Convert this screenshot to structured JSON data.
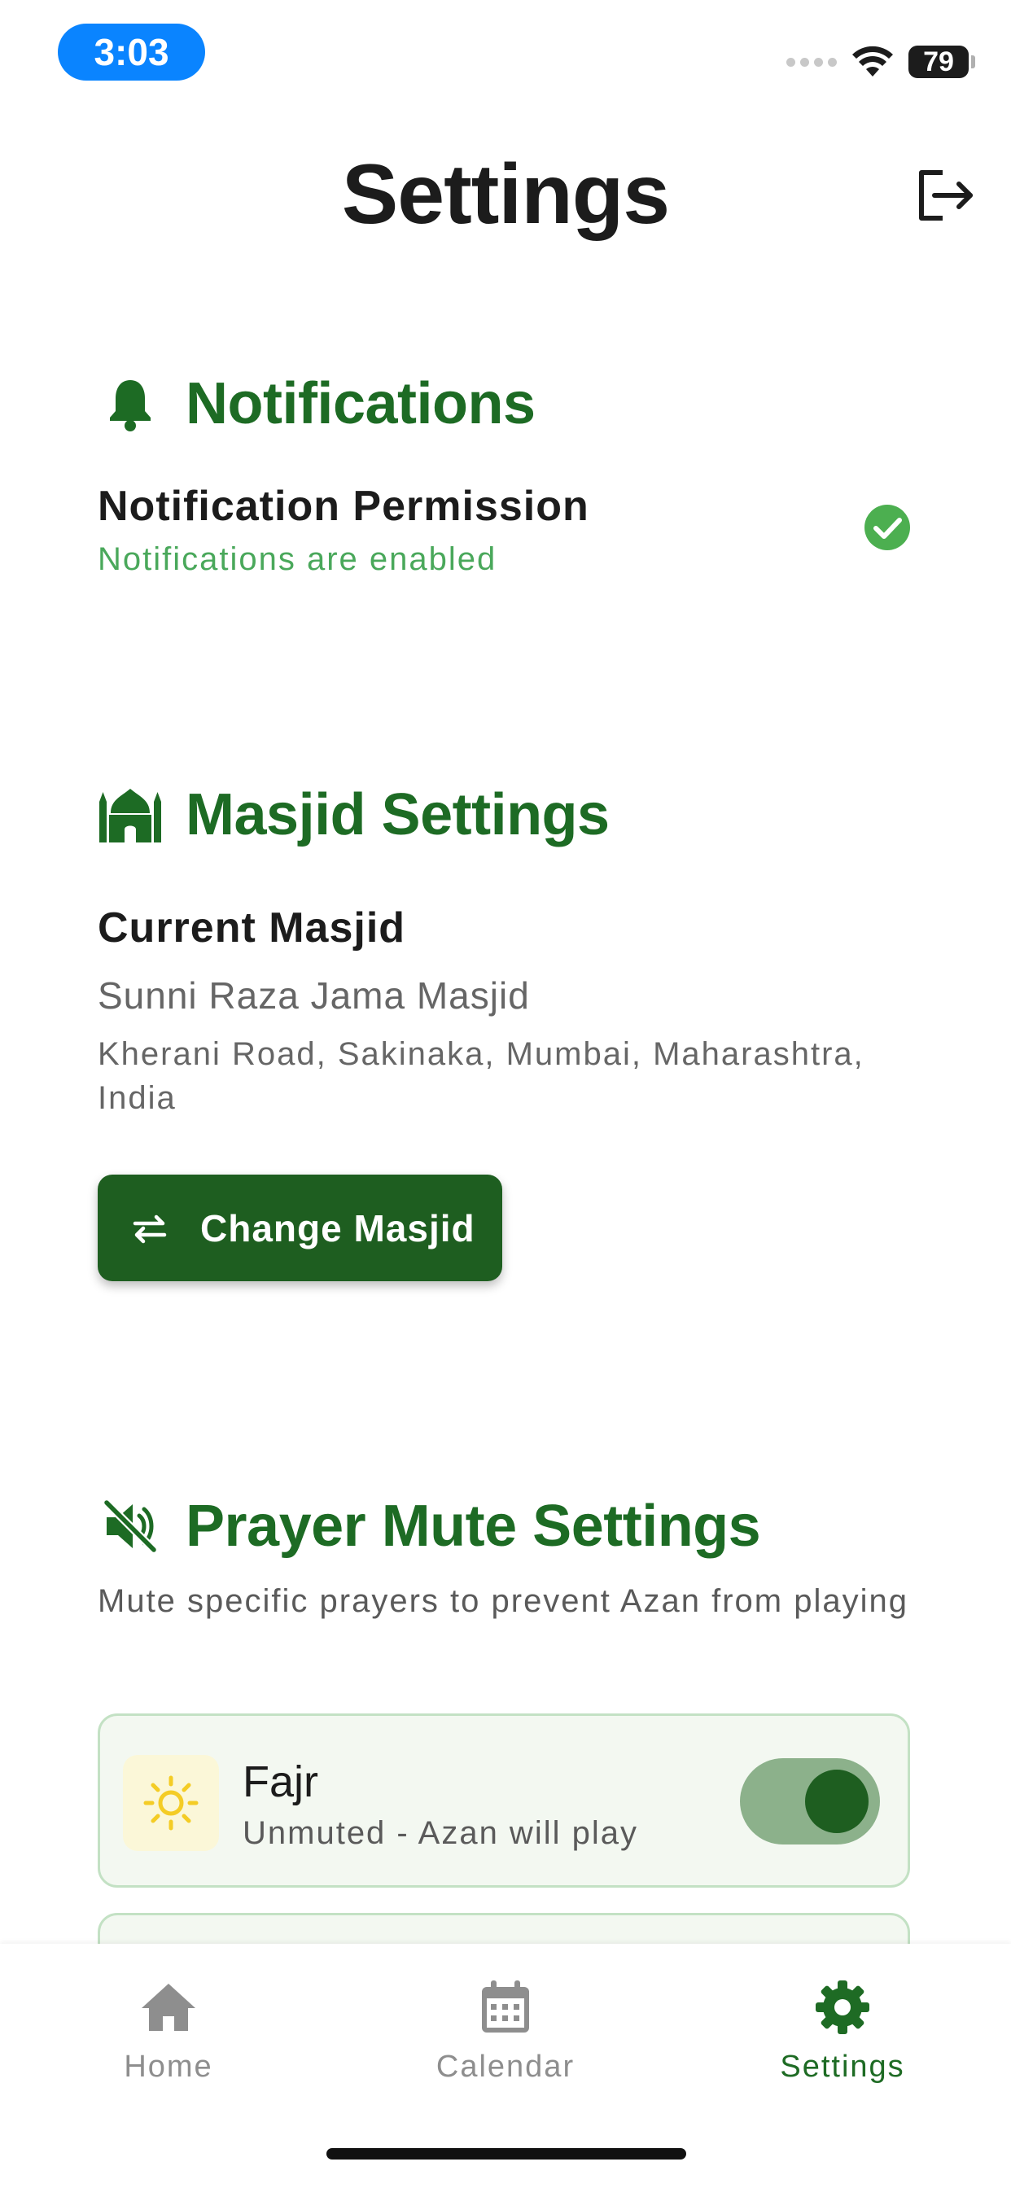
{
  "status_bar": {
    "time": "3:03",
    "battery": "79"
  },
  "page": {
    "title": "Settings"
  },
  "notifications": {
    "heading": "Notifications",
    "permission_label": "Notification Permission",
    "permission_status": "Notifications are enabled"
  },
  "masjid": {
    "heading": "Masjid Settings",
    "current_label": "Current Masjid",
    "name": "Sunni Raza Jama Masjid",
    "address": "Kherani Road, Sakinaka, Mumbai, Maharashtra, India",
    "change_button": "Change Masjid"
  },
  "prayer_mute": {
    "heading": "Prayer Mute Settings",
    "description": "Mute specific prayers to prevent Azan from playing",
    "prayers": [
      {
        "name": "Fajr",
        "status": "Unmuted - Azan will play",
        "enabled": true
      }
    ]
  },
  "nav": {
    "items": [
      {
        "label": "Home",
        "icon": "home-icon"
      },
      {
        "label": "Calendar",
        "icon": "calendar-icon"
      },
      {
        "label": "Settings",
        "icon": "gear-icon",
        "active": true
      }
    ]
  },
  "colors": {
    "primary": "#1e5e20",
    "heading_green": "#1d6b24",
    "status_green": "#4aa85b",
    "status_pill": "#0a84ff"
  }
}
